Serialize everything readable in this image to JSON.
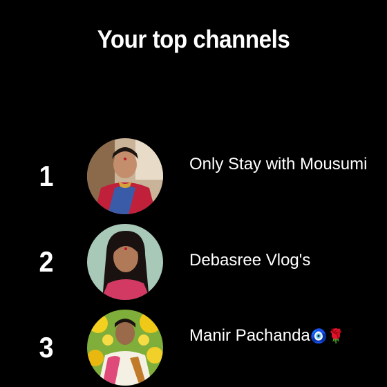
{
  "header": {
    "title": "Your top channels"
  },
  "channels": [
    {
      "rank": "1",
      "name": "Only Stay with Mousumi",
      "avatar_icon": "woman-red-saree-avatar",
      "emoji": ""
    },
    {
      "rank": "2",
      "name": "Debasree Vlog's",
      "avatar_icon": "woman-dark-hair-avatar",
      "emoji": ""
    },
    {
      "rank": "3",
      "name": "Manir Pachanda",
      "avatar_icon": "woman-flowers-avatar",
      "emoji": "🧿🌹"
    }
  ],
  "colors": {
    "background": "#000000",
    "text": "#ffffff"
  }
}
